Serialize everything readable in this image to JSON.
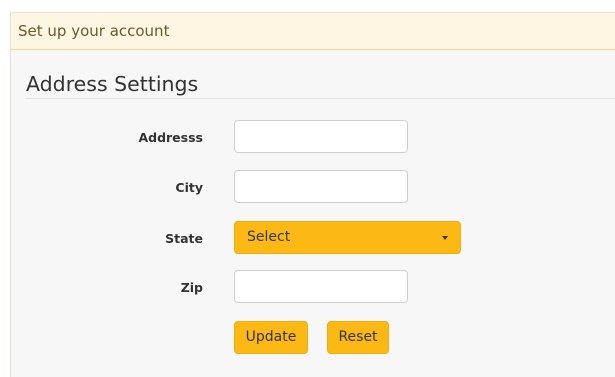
{
  "panel": {
    "header_title": "Set up your account"
  },
  "section": {
    "title": "Address Settings"
  },
  "form": {
    "address_label": "Addresss",
    "address_value": "",
    "city_label": "City",
    "city_value": "",
    "state_label": "State",
    "state_selected": "Select",
    "zip_label": "Zip",
    "zip_value": ""
  },
  "actions": {
    "update_label": "Update",
    "reset_label": "Reset"
  },
  "icons": {
    "state_dropdown": "caret-down-icon"
  },
  "colors": {
    "accent": "#fdb913",
    "header_bg": "#fdf6e3",
    "header_border": "#f0d78c",
    "panel_bg": "#f7f7f7"
  }
}
